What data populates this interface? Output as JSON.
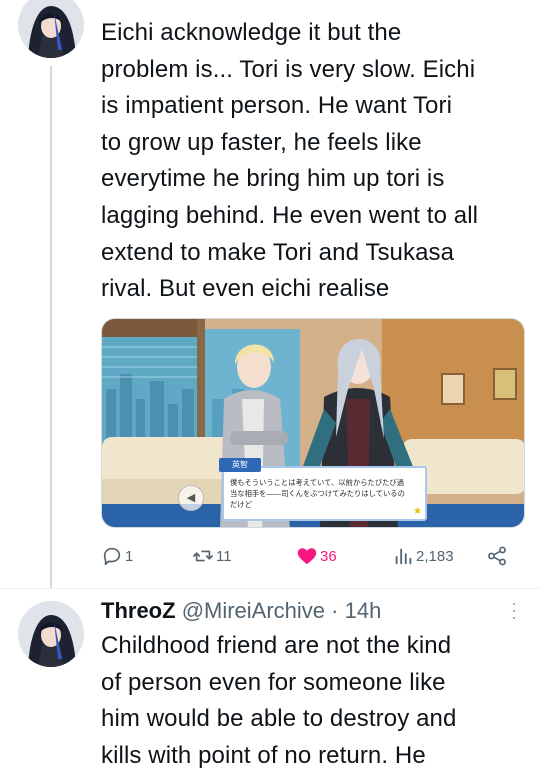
{
  "tweet1": {
    "lines": [
      "Eichi acknowledge it but the",
      "problem is... Tori is very slow. Eichi",
      "is impatient person. He want Tori",
      "to grow up faster, he feels like",
      "everytime he bring him up tori is",
      "lagging behind. He even went to all",
      "extend to make Tori and Tsukasa",
      "rival. But even eichi realise"
    ],
    "media": {
      "speaker_name": "英智",
      "dialog_lines": [
        "僕もそういうことは考えていて、以前からたびたび過",
        "当な相手を——司くんをぶつけてみたりはしているの",
        "だけど"
      ]
    },
    "actions": {
      "replies": "1",
      "retweets": "11",
      "likes": "36",
      "views": "2,183"
    }
  },
  "tweet2": {
    "display_name": "ThreoZ",
    "handle": "@MireiArchive",
    "separator": "·",
    "time": "14h",
    "lines": [
      "Childhood friend are not the kind",
      "of person even for someone like",
      "him would be able to destroy and",
      "kills with point of no return. He"
    ]
  },
  "colors": {
    "like": "#f91880",
    "muted": "#536471",
    "text": "#0f1419"
  }
}
